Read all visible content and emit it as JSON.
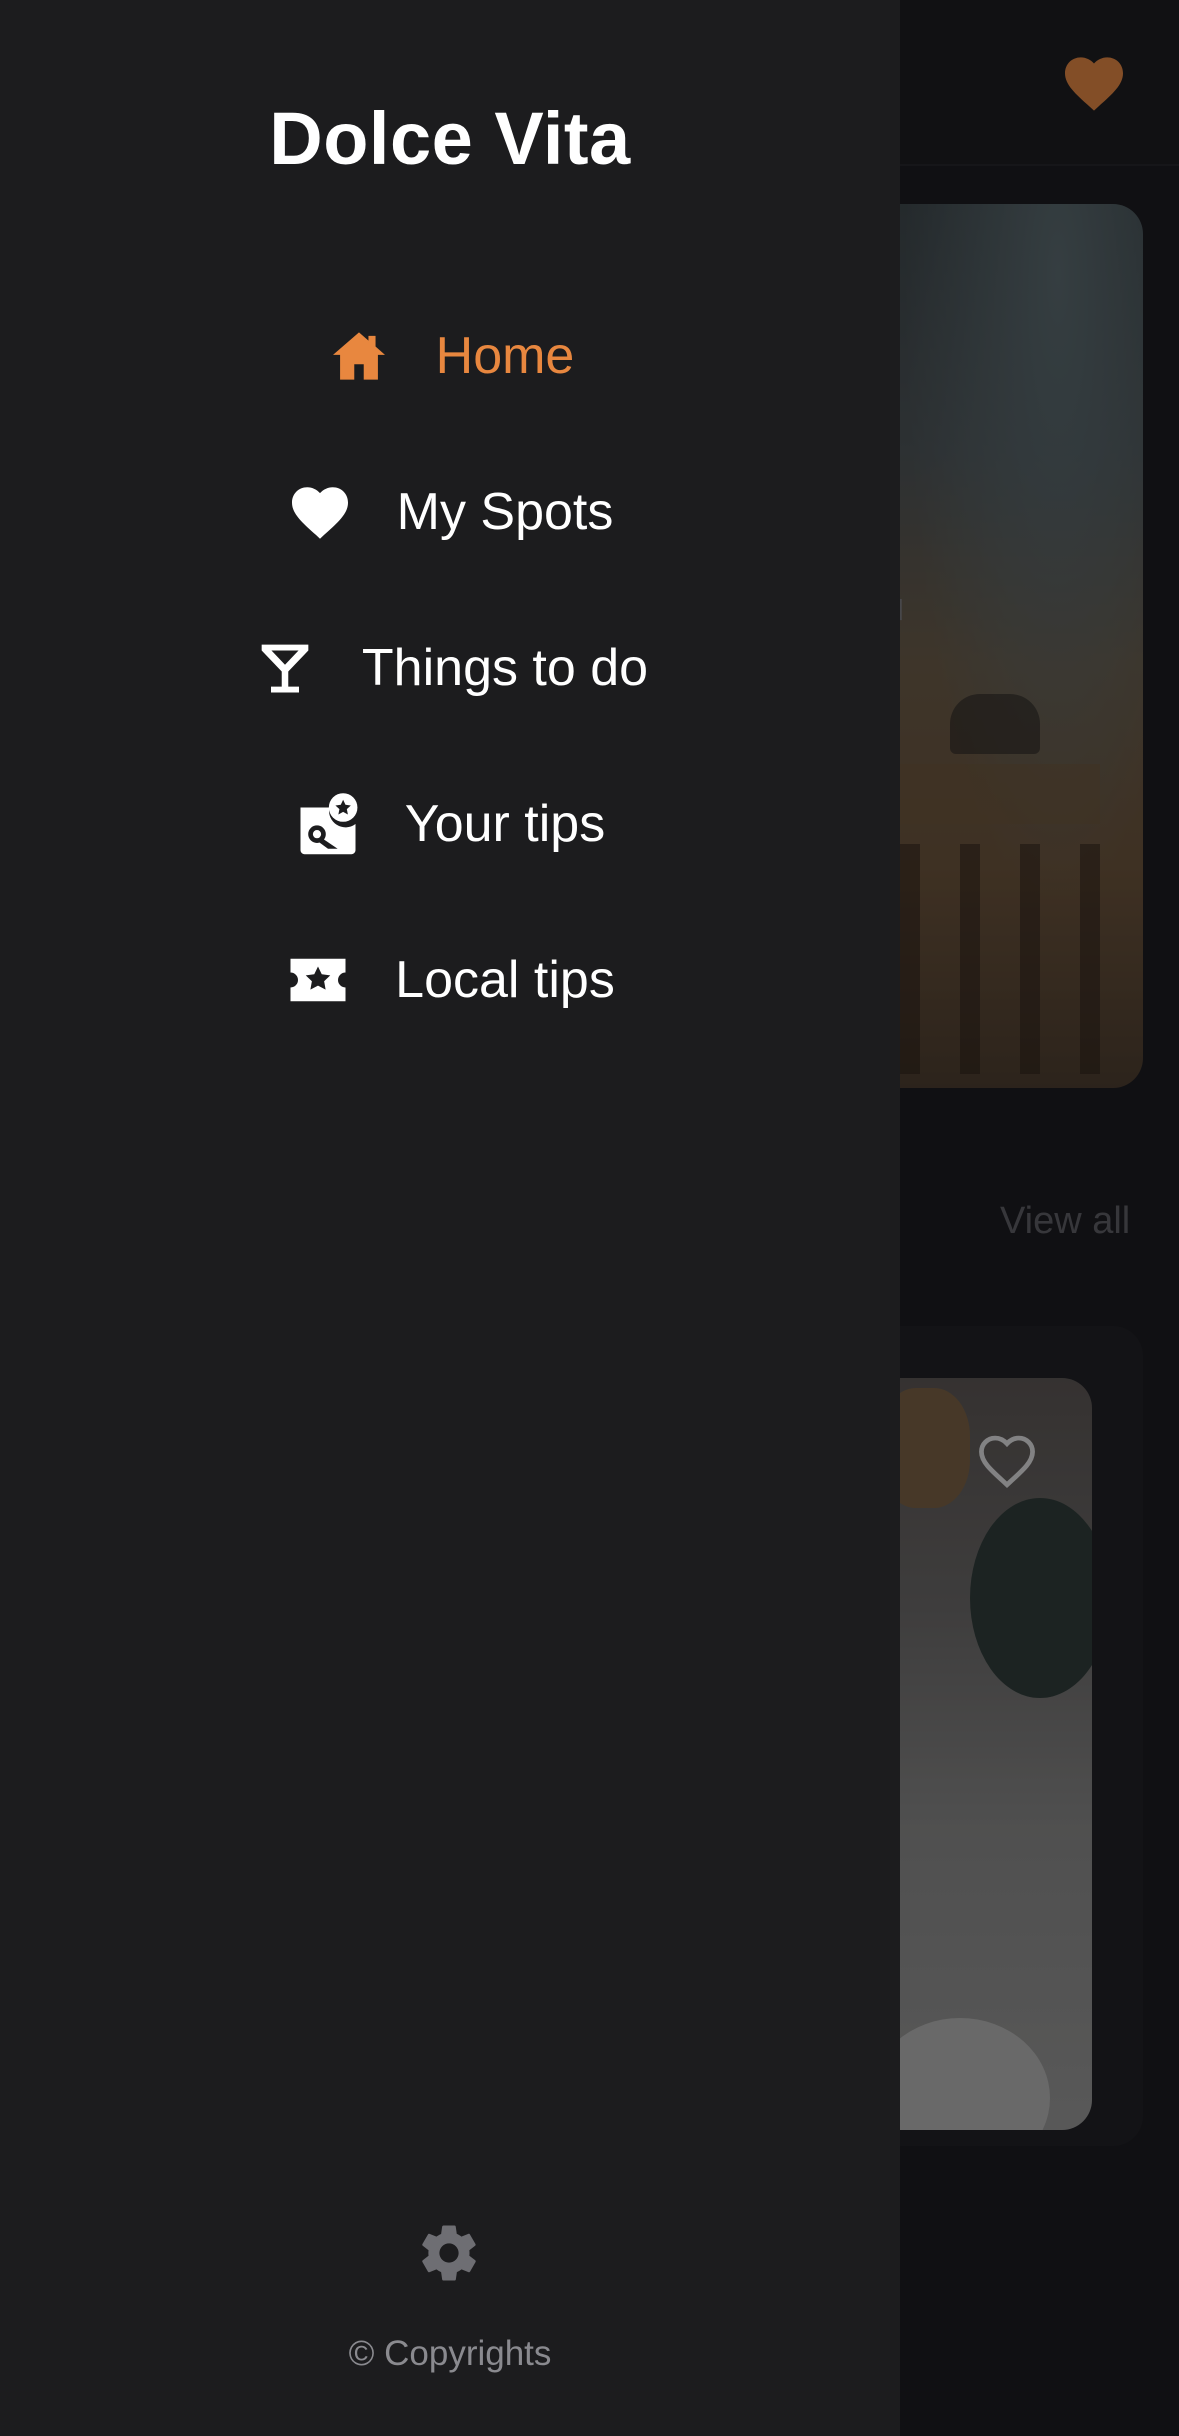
{
  "colors": {
    "accent": "#e8873f",
    "drawer_bg": "#1c1c1e",
    "text": "#ffffff",
    "muted": "#8a8a8f"
  },
  "drawer": {
    "title": "Dolce Vita",
    "items": [
      {
        "label": "Home",
        "icon": "home-icon",
        "active": true
      },
      {
        "label": "My Spots",
        "icon": "heart-icon",
        "active": false
      },
      {
        "label": "Things to do",
        "icon": "cocktail-icon",
        "active": false
      },
      {
        "label": "Your tips",
        "icon": "map-pin-star-icon",
        "active": false
      },
      {
        "label": "Local tips",
        "icon": "ticket-star-icon",
        "active": false
      }
    ],
    "settings_icon": "gear-icon",
    "copyright": "© Copyrights"
  },
  "background": {
    "header_icon": "heart-icon",
    "hero_text_fragment": "ou",
    "view_all": "View all",
    "card_icon": "heart-outline-icon"
  }
}
